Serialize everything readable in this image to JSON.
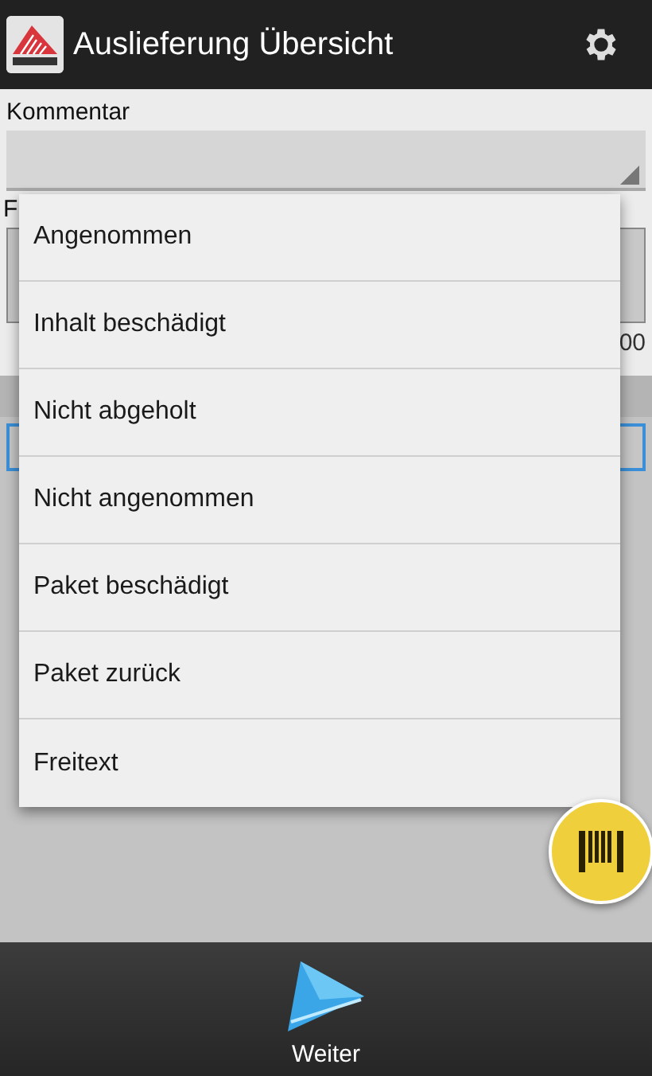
{
  "header": {
    "title": "Auslieferung Übersicht"
  },
  "form": {
    "comment_label": "Kommentar",
    "label_2": "F",
    "field_value_end": "00"
  },
  "dropdown": {
    "options": [
      "Angenommen",
      "Inhalt beschädigt",
      "Nicht abgeholt",
      "Nicht angenommen",
      "Paket beschädigt",
      "Paket zurück",
      "Freitext"
    ]
  },
  "bottom_bar": {
    "button": "Weiter"
  }
}
